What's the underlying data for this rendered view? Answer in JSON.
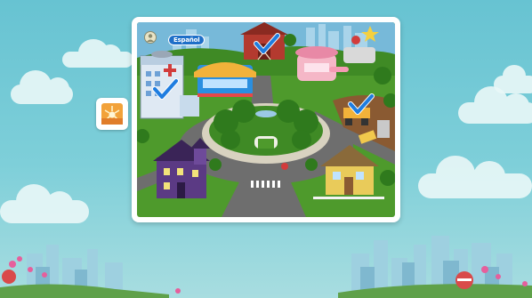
{
  "screen": {
    "title": "",
    "background_color": "#67c3d2"
  },
  "side_button": {
    "icon": "sunburst-icon"
  },
  "map": {
    "language_button_label": "Español",
    "avatar_icon": "avatar-icon",
    "locations": [
      {
        "id": "hospital",
        "completed": true
      },
      {
        "id": "diner",
        "completed": false
      },
      {
        "id": "barn",
        "completed": true
      },
      {
        "id": "beauty-salon",
        "completed": false
      },
      {
        "id": "construction-site",
        "completed": true
      },
      {
        "id": "haunted-house",
        "completed": false
      },
      {
        "id": "yellow-house",
        "completed": false
      },
      {
        "id": "city-park",
        "completed": false
      },
      {
        "id": "star-stadium",
        "completed": false
      }
    ],
    "checkmark_color": "#1f7de0",
    "colors": {
      "grass": "#4e9a2c",
      "road": "#6e6e6e",
      "hospital": "#dfe9f3",
      "diner": "#2a8fe0",
      "barn": "#b43a2f",
      "salon": "#f5b7c7",
      "haunted": "#5b3a84",
      "yellow_house": "#e9cb5a"
    }
  }
}
